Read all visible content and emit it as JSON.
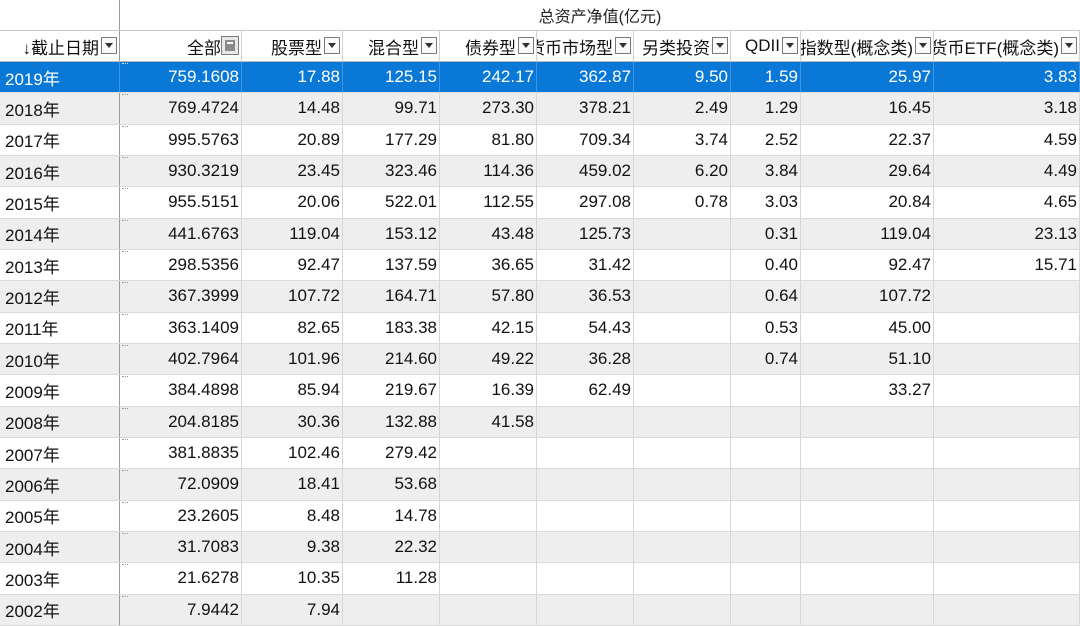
{
  "group_header": "总资产净值(亿元)",
  "columns": [
    {
      "label": "↓截止日期",
      "control": "dropdown"
    },
    {
      "label": "全部",
      "control": "filter"
    },
    {
      "label": "股票型",
      "control": "dropdown"
    },
    {
      "label": "混合型",
      "control": "dropdown"
    },
    {
      "label": "债券型",
      "control": "dropdown"
    },
    {
      "label": "货币市场型",
      "control": "dropdown"
    },
    {
      "label": "另类投资",
      "control": "dropdown"
    },
    {
      "label": "QDII",
      "control": "dropdown"
    },
    {
      "label": "指数型(概念类)",
      "control": "dropdown"
    },
    {
      "label": "非货币ETF(概念类)",
      "control": "dropdown"
    }
  ],
  "selected_row": 0,
  "rows": [
    [
      "2019年",
      "759.1608",
      "17.88",
      "125.15",
      "242.17",
      "362.87",
      "9.50",
      "1.59",
      "25.97",
      "3.83"
    ],
    [
      "2018年",
      "769.4724",
      "14.48",
      "99.71",
      "273.30",
      "378.21",
      "2.49",
      "1.29",
      "16.45",
      "3.18"
    ],
    [
      "2017年",
      "995.5763",
      "20.89",
      "177.29",
      "81.80",
      "709.34",
      "3.74",
      "2.52",
      "22.37",
      "4.59"
    ],
    [
      "2016年",
      "930.3219",
      "23.45",
      "323.46",
      "114.36",
      "459.02",
      "6.20",
      "3.84",
      "29.64",
      "4.49"
    ],
    [
      "2015年",
      "955.5151",
      "20.06",
      "522.01",
      "112.55",
      "297.08",
      "0.78",
      "3.03",
      "20.84",
      "4.65"
    ],
    [
      "2014年",
      "441.6763",
      "119.04",
      "153.12",
      "43.48",
      "125.73",
      "",
      "0.31",
      "119.04",
      "23.13"
    ],
    [
      "2013年",
      "298.5356",
      "92.47",
      "137.59",
      "36.65",
      "31.42",
      "",
      "0.40",
      "92.47",
      "15.71"
    ],
    [
      "2012年",
      "367.3999",
      "107.72",
      "164.71",
      "57.80",
      "36.53",
      "",
      "0.64",
      "107.72",
      ""
    ],
    [
      "2011年",
      "363.1409",
      "82.65",
      "183.38",
      "42.15",
      "54.43",
      "",
      "0.53",
      "45.00",
      ""
    ],
    [
      "2010年",
      "402.7964",
      "101.96",
      "214.60",
      "49.22",
      "36.28",
      "",
      "0.74",
      "51.10",
      ""
    ],
    [
      "2009年",
      "384.4898",
      "85.94",
      "219.67",
      "16.39",
      "62.49",
      "",
      "",
      "33.27",
      ""
    ],
    [
      "2008年",
      "204.8185",
      "30.36",
      "132.88",
      "41.58",
      "",
      "",
      "",
      "",
      ""
    ],
    [
      "2007年",
      "381.8835",
      "102.46",
      "279.42",
      "",
      "",
      "",
      "",
      "",
      ""
    ],
    [
      "2006年",
      "72.0909",
      "18.41",
      "53.68",
      "",
      "",
      "",
      "",
      "",
      ""
    ],
    [
      "2005年",
      "23.2605",
      "8.48",
      "14.78",
      "",
      "",
      "",
      "",
      "",
      ""
    ],
    [
      "2004年",
      "31.7083",
      "9.38",
      "22.32",
      "",
      "",
      "",
      "",
      "",
      ""
    ],
    [
      "2003年",
      "21.6278",
      "10.35",
      "11.28",
      "",
      "",
      "",
      "",
      "",
      ""
    ],
    [
      "2002年",
      "7.9442",
      "7.94",
      "",
      "",
      "",
      "",
      "",
      "",
      ""
    ]
  ]
}
